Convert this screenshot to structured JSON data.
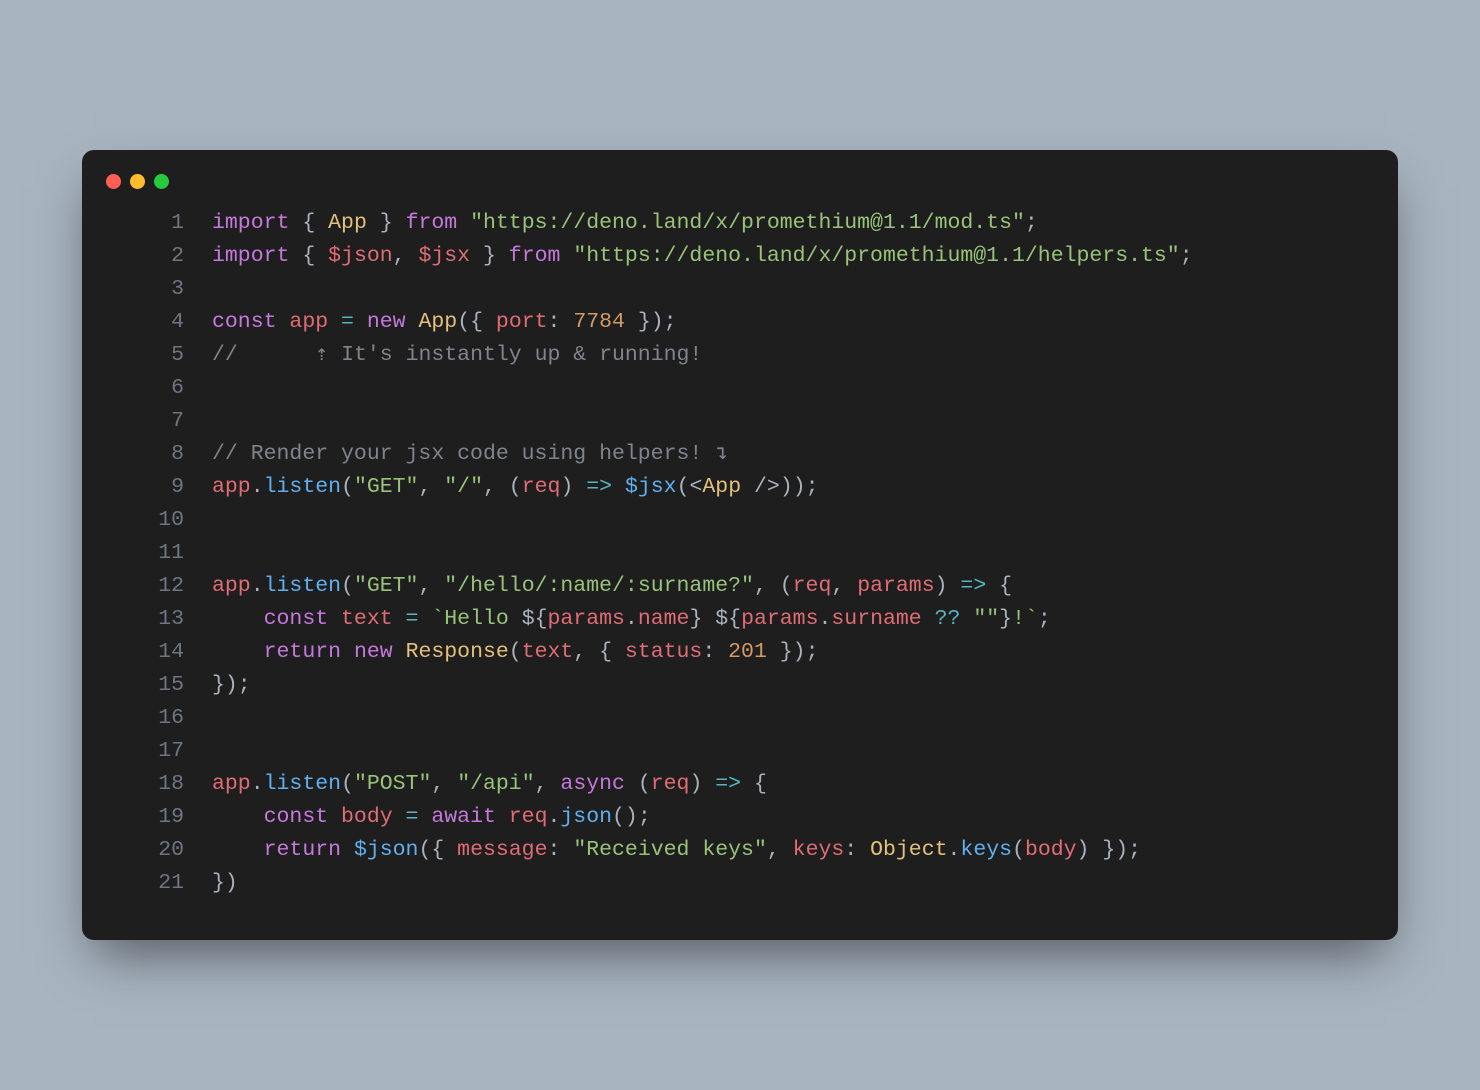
{
  "window": {
    "traffic_lights": [
      "close",
      "minimize",
      "zoom"
    ]
  },
  "code": {
    "lines": [
      {
        "n": 1,
        "tokens": [
          {
            "c": "kw",
            "t": "import"
          },
          {
            "c": "pn",
            "t": " { "
          },
          {
            "c": "cls",
            "t": "App"
          },
          {
            "c": "pn",
            "t": " } "
          },
          {
            "c": "kw",
            "t": "from"
          },
          {
            "c": "pn",
            "t": " "
          },
          {
            "c": "str",
            "t": "\"https://deno.land/x/promethium@1.1/mod.ts\""
          },
          {
            "c": "pn",
            "t": ";"
          }
        ]
      },
      {
        "n": 2,
        "tokens": [
          {
            "c": "kw",
            "t": "import"
          },
          {
            "c": "pn",
            "t": " { "
          },
          {
            "c": "var",
            "t": "$json"
          },
          {
            "c": "pn",
            "t": ", "
          },
          {
            "c": "var",
            "t": "$jsx"
          },
          {
            "c": "pn",
            "t": " } "
          },
          {
            "c": "kw",
            "t": "from"
          },
          {
            "c": "pn",
            "t": " "
          },
          {
            "c": "str",
            "t": "\"https://deno.land/x/promethium@1.1/helpers.ts\""
          },
          {
            "c": "pn",
            "t": ";"
          }
        ]
      },
      {
        "n": 3,
        "tokens": []
      },
      {
        "n": 4,
        "tokens": [
          {
            "c": "kw",
            "t": "const"
          },
          {
            "c": "pn",
            "t": " "
          },
          {
            "c": "var",
            "t": "app"
          },
          {
            "c": "pn",
            "t": " "
          },
          {
            "c": "op",
            "t": "="
          },
          {
            "c": "pn",
            "t": " "
          },
          {
            "c": "kw",
            "t": "new"
          },
          {
            "c": "pn",
            "t": " "
          },
          {
            "c": "cls",
            "t": "App"
          },
          {
            "c": "pn",
            "t": "({ "
          },
          {
            "c": "prop",
            "t": "port"
          },
          {
            "c": "pn",
            "t": ": "
          },
          {
            "c": "num",
            "t": "7784"
          },
          {
            "c": "pn",
            "t": " });"
          }
        ]
      },
      {
        "n": 5,
        "tokens": [
          {
            "c": "cmt",
            "t": "//      ⇡ It's instantly up & running!"
          }
        ]
      },
      {
        "n": 6,
        "tokens": []
      },
      {
        "n": 7,
        "tokens": []
      },
      {
        "n": 8,
        "tokens": [
          {
            "c": "cmt",
            "t": "// Render your jsx code using helpers! ↴"
          }
        ]
      },
      {
        "n": 9,
        "tokens": [
          {
            "c": "var",
            "t": "app"
          },
          {
            "c": "pn",
            "t": "."
          },
          {
            "c": "fn",
            "t": "listen"
          },
          {
            "c": "pn",
            "t": "("
          },
          {
            "c": "str",
            "t": "\"GET\""
          },
          {
            "c": "pn",
            "t": ", "
          },
          {
            "c": "str",
            "t": "\"/\""
          },
          {
            "c": "pn",
            "t": ", ("
          },
          {
            "c": "var",
            "t": "req"
          },
          {
            "c": "pn",
            "t": ") "
          },
          {
            "c": "op",
            "t": "=>"
          },
          {
            "c": "pn",
            "t": " "
          },
          {
            "c": "fn",
            "t": "$jsx"
          },
          {
            "c": "pn",
            "t": "(<"
          },
          {
            "c": "cls",
            "t": "App"
          },
          {
            "c": "pn",
            "t": " />));"
          }
        ]
      },
      {
        "n": 10,
        "tokens": []
      },
      {
        "n": 11,
        "tokens": []
      },
      {
        "n": 12,
        "tokens": [
          {
            "c": "var",
            "t": "app"
          },
          {
            "c": "pn",
            "t": "."
          },
          {
            "c": "fn",
            "t": "listen"
          },
          {
            "c": "pn",
            "t": "("
          },
          {
            "c": "str",
            "t": "\"GET\""
          },
          {
            "c": "pn",
            "t": ", "
          },
          {
            "c": "str",
            "t": "\"/hello/:name/:surname?\""
          },
          {
            "c": "pn",
            "t": ", ("
          },
          {
            "c": "var",
            "t": "req"
          },
          {
            "c": "pn",
            "t": ", "
          },
          {
            "c": "var",
            "t": "params"
          },
          {
            "c": "pn",
            "t": ") "
          },
          {
            "c": "op",
            "t": "=>"
          },
          {
            "c": "pn",
            "t": " {"
          }
        ]
      },
      {
        "n": 13,
        "tokens": [
          {
            "c": "pn",
            "t": "    "
          },
          {
            "c": "kw",
            "t": "const"
          },
          {
            "c": "pn",
            "t": " "
          },
          {
            "c": "var",
            "t": "text"
          },
          {
            "c": "pn",
            "t": " "
          },
          {
            "c": "op",
            "t": "="
          },
          {
            "c": "pn",
            "t": " "
          },
          {
            "c": "str",
            "t": "`Hello "
          },
          {
            "c": "pn",
            "t": "${"
          },
          {
            "c": "var",
            "t": "params"
          },
          {
            "c": "pn",
            "t": "."
          },
          {
            "c": "prop",
            "t": "name"
          },
          {
            "c": "pn",
            "t": "}"
          },
          {
            "c": "str",
            "t": " "
          },
          {
            "c": "pn",
            "t": "${"
          },
          {
            "c": "var",
            "t": "params"
          },
          {
            "c": "pn",
            "t": "."
          },
          {
            "c": "prop",
            "t": "surname"
          },
          {
            "c": "pn",
            "t": " "
          },
          {
            "c": "op",
            "t": "??"
          },
          {
            "c": "pn",
            "t": " "
          },
          {
            "c": "str",
            "t": "\"\""
          },
          {
            "c": "pn",
            "t": "}"
          },
          {
            "c": "str",
            "t": "!`"
          },
          {
            "c": "pn",
            "t": ";"
          }
        ]
      },
      {
        "n": 14,
        "tokens": [
          {
            "c": "pn",
            "t": "    "
          },
          {
            "c": "kw",
            "t": "return"
          },
          {
            "c": "pn",
            "t": " "
          },
          {
            "c": "kw",
            "t": "new"
          },
          {
            "c": "pn",
            "t": " "
          },
          {
            "c": "glob",
            "t": "Response"
          },
          {
            "c": "pn",
            "t": "("
          },
          {
            "c": "var",
            "t": "text"
          },
          {
            "c": "pn",
            "t": ", { "
          },
          {
            "c": "prop",
            "t": "status"
          },
          {
            "c": "pn",
            "t": ": "
          },
          {
            "c": "num",
            "t": "201"
          },
          {
            "c": "pn",
            "t": " });"
          }
        ]
      },
      {
        "n": 15,
        "tokens": [
          {
            "c": "pn",
            "t": "});"
          }
        ]
      },
      {
        "n": 16,
        "tokens": []
      },
      {
        "n": 17,
        "tokens": []
      },
      {
        "n": 18,
        "tokens": [
          {
            "c": "var",
            "t": "app"
          },
          {
            "c": "pn",
            "t": "."
          },
          {
            "c": "fn",
            "t": "listen"
          },
          {
            "c": "pn",
            "t": "("
          },
          {
            "c": "str",
            "t": "\"POST\""
          },
          {
            "c": "pn",
            "t": ", "
          },
          {
            "c": "str",
            "t": "\"/api\""
          },
          {
            "c": "pn",
            "t": ", "
          },
          {
            "c": "kw",
            "t": "async"
          },
          {
            "c": "pn",
            "t": " ("
          },
          {
            "c": "var",
            "t": "req"
          },
          {
            "c": "pn",
            "t": ") "
          },
          {
            "c": "op",
            "t": "=>"
          },
          {
            "c": "pn",
            "t": " {"
          }
        ]
      },
      {
        "n": 19,
        "tokens": [
          {
            "c": "pn",
            "t": "    "
          },
          {
            "c": "kw",
            "t": "const"
          },
          {
            "c": "pn",
            "t": " "
          },
          {
            "c": "var",
            "t": "body"
          },
          {
            "c": "pn",
            "t": " "
          },
          {
            "c": "op",
            "t": "="
          },
          {
            "c": "pn",
            "t": " "
          },
          {
            "c": "kw",
            "t": "await"
          },
          {
            "c": "pn",
            "t": " "
          },
          {
            "c": "var",
            "t": "req"
          },
          {
            "c": "pn",
            "t": "."
          },
          {
            "c": "fn",
            "t": "json"
          },
          {
            "c": "pn",
            "t": "();"
          }
        ]
      },
      {
        "n": 20,
        "tokens": [
          {
            "c": "pn",
            "t": "    "
          },
          {
            "c": "kw",
            "t": "return"
          },
          {
            "c": "pn",
            "t": " "
          },
          {
            "c": "fn",
            "t": "$json"
          },
          {
            "c": "pn",
            "t": "({ "
          },
          {
            "c": "prop",
            "t": "message"
          },
          {
            "c": "pn",
            "t": ": "
          },
          {
            "c": "str",
            "t": "\"Received keys\""
          },
          {
            "c": "pn",
            "t": ", "
          },
          {
            "c": "prop",
            "t": "keys"
          },
          {
            "c": "pn",
            "t": ": "
          },
          {
            "c": "glob",
            "t": "Object"
          },
          {
            "c": "pn",
            "t": "."
          },
          {
            "c": "fn",
            "t": "keys"
          },
          {
            "c": "pn",
            "t": "("
          },
          {
            "c": "var",
            "t": "body"
          },
          {
            "c": "pn",
            "t": ") });"
          }
        ]
      },
      {
        "n": 21,
        "tokens": [
          {
            "c": "pn",
            "t": "})"
          }
        ]
      }
    ]
  }
}
